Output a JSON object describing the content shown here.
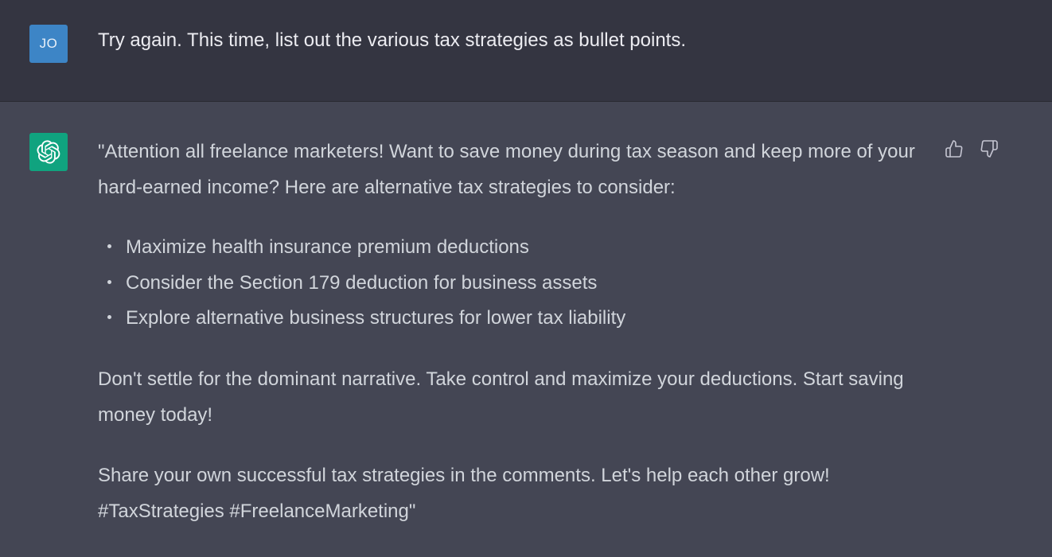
{
  "user_message": {
    "avatar_initials": "JO",
    "text": "Try again. This time, list out the various tax strategies as bullet points."
  },
  "assistant_message": {
    "avatar_icon": "openai-logo-icon",
    "intro": "\"Attention all freelance marketers! Want to save money during tax season and keep more of your hard-earned income? Here are alternative tax strategies to consider:",
    "bullets": [
      "Maximize health insurance premium deductions",
      "Consider the Section 179 deduction for business assets",
      "Explore alternative business structures for lower tax liability"
    ],
    "paragraph_2": "Don't settle for the dominant narrative. Take control and maximize your deductions. Start saving money today!",
    "paragraph_3": "Share your own successful tax strategies in the comments. Let's help each other grow! #TaxStrategies #FreelanceMarketing\""
  },
  "feedback": {
    "thumbs_up_icon": "thumbs-up-icon",
    "thumbs_down_icon": "thumbs-down-icon"
  },
  "colors": {
    "user_bg": "#343541",
    "assistant_bg": "#444654",
    "user_avatar": "#3d85c6",
    "assistant_avatar": "#10a37f",
    "text": "#d1d5db"
  }
}
